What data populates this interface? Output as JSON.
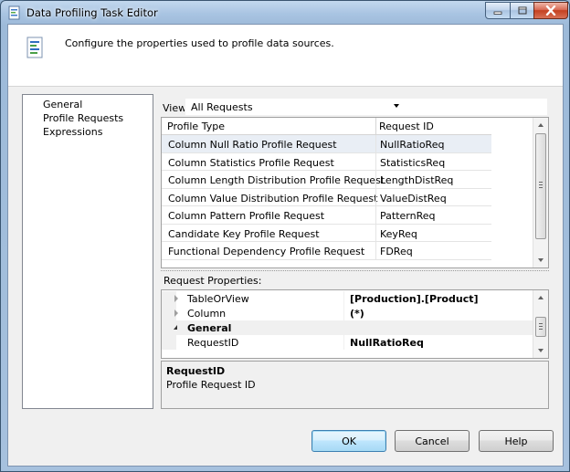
{
  "window": {
    "title": "Data Profiling Task Editor",
    "icons": {
      "app": "data-profiling-icon",
      "minimize": "minimize-icon",
      "maximize": "maximize-icon",
      "close": "close-icon"
    }
  },
  "header": {
    "icon": "profile-document-icon",
    "text": "Configure the properties used to profile data sources."
  },
  "nav": {
    "items": [
      {
        "label": "General"
      },
      {
        "label": "Profile Requests"
      },
      {
        "label": "Expressions"
      }
    ]
  },
  "view": {
    "label": "View",
    "selected": "All Requests"
  },
  "grid": {
    "columns": [
      "Profile Type",
      "Request ID"
    ],
    "rows": [
      {
        "type": "Column Null Ratio Profile Request",
        "id": "NullRatioReq",
        "selected": true
      },
      {
        "type": "Column Statistics Profile Request",
        "id": "StatisticsReq"
      },
      {
        "type": "Column Length Distribution Profile Request",
        "id": "LengthDistReq"
      },
      {
        "type": "Column Value Distribution Profile Request",
        "id": "ValueDistReq"
      },
      {
        "type": "Column Pattern Profile Request",
        "id": "PatternReq"
      },
      {
        "type": "Candidate Key Profile Request",
        "id": "KeyReq"
      },
      {
        "type": "Functional Dependency Profile Request",
        "id": "FDReq"
      }
    ]
  },
  "request_properties": {
    "label": "Request Properties:",
    "rows": [
      {
        "name": "TableOrView",
        "value": "[Production].[Product]",
        "kind": "expandable"
      },
      {
        "name": "Column",
        "value": "(*)",
        "kind": "expandable"
      },
      {
        "name": "General",
        "value": "",
        "kind": "category"
      },
      {
        "name": "RequestID",
        "value": "NullRatioReq",
        "kind": "property"
      }
    ]
  },
  "description": {
    "title": "RequestID",
    "body": "Profile Request ID"
  },
  "buttons": {
    "ok": "OK",
    "cancel": "Cancel",
    "help": "Help"
  }
}
